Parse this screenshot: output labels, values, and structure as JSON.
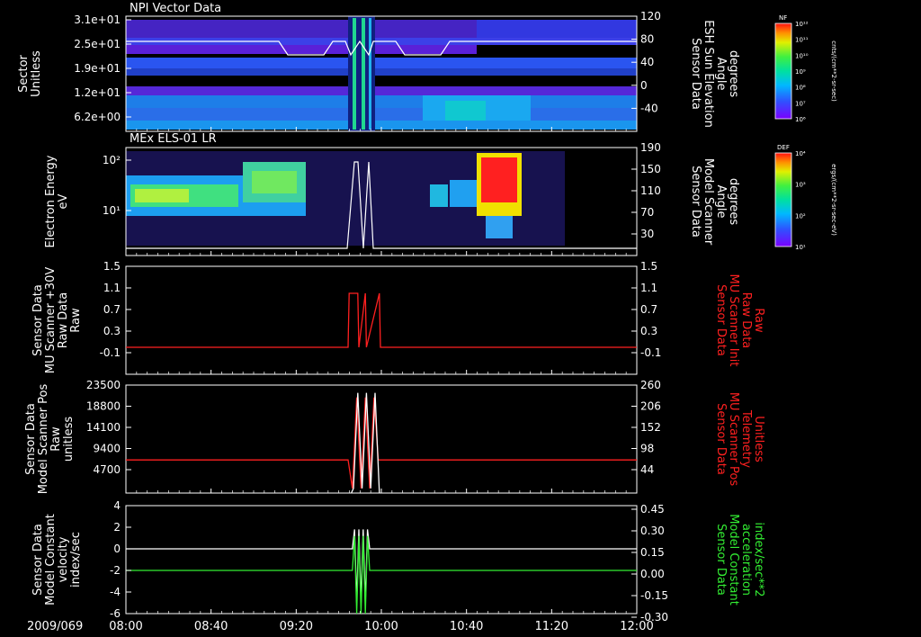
{
  "chart_data": [
    {
      "type": "heatmap",
      "panel": 1,
      "title": "NPI Vector Data",
      "ylabel": [
        "Sector",
        "Unitless"
      ],
      "yticks": [
        "3.1e+01",
        "2.5e+01",
        "1.9e+01",
        "1.2e+01",
        "6.2e+00"
      ],
      "y2label": [
        "Sensor Data",
        "ESH Sun Elevation",
        "Angle",
        "degrees"
      ],
      "y2ticks": [
        "120",
        "80",
        "40",
        "0",
        "-40"
      ],
      "y2lim": [
        -80,
        120
      ],
      "colorbar_label": "NF",
      "colorbar_units": "cnts/(cm**2-sr-sec)",
      "colorbar_ticks": [
        "10¹²",
        "10¹¹",
        "10¹⁰",
        "10⁹",
        "10⁸",
        "10⁷",
        "10⁶"
      ]
    },
    {
      "type": "heatmap",
      "panel": 2,
      "title": "MEx ELS-01 LR",
      "ylabel": [
        "Electron Energy",
        "eV"
      ],
      "yticks": [
        "10²",
        "10¹"
      ],
      "y2label": [
        "Sensor Data",
        "Model Scanner",
        "Angle",
        "degrees"
      ],
      "y2ticks": [
        "190",
        "150",
        "110",
        "70",
        "30"
      ],
      "y2lim": [
        0,
        190
      ],
      "colorbar_label": "DEF",
      "colorbar_units": "ergs/(cm**2-sr-sec-eV)",
      "colorbar_ticks": [
        "10⁴",
        "10³",
        "10²",
        "10¹"
      ]
    },
    {
      "type": "line",
      "panel": 3,
      "ylabel": [
        "Sensor Data",
        "MU Scanner +30V",
        "Raw Data",
        "Raw"
      ],
      "yticks": [
        "1.5",
        "1.1",
        "0.7",
        "0.3",
        "-0.1"
      ],
      "ylim": [
        -0.3,
        1.5
      ],
      "y2label": [
        "Sensor Data",
        "MU Scanner Init",
        "Raw Data",
        "Raw"
      ],
      "y2ticks": [
        "1.5",
        "1.1",
        "0.7",
        "0.3",
        "-0.1"
      ],
      "series": [
        {
          "color": "#ff2020",
          "x": [
            0,
            76,
            77,
            85,
            86,
            92,
            93,
            105,
            106,
            200
          ],
          "y": [
            0,
            0,
            1,
            1,
            0,
            1,
            0,
            1,
            0,
            0
          ]
        }
      ]
    },
    {
      "type": "line",
      "panel": 4,
      "ylabel": [
        "Sensor Data",
        "Model Scanner Pos",
        "Raw",
        "unitless"
      ],
      "yticks": [
        "23500",
        "18800",
        "14100",
        "9400",
        "4700"
      ],
      "ylim": [
        0,
        23500
      ],
      "y2label": [
        "Sensor Data",
        "MU Scanner Pos",
        "Telemetry",
        "Unitless"
      ],
      "y2ticks": [
        "260",
        "206",
        "152",
        "98",
        "44"
      ],
      "series": [
        {
          "color": "#ff2020",
          "x": [
            0,
            76,
            80,
            84,
            88,
            92,
            96,
            100,
            104,
            200
          ],
          "y": [
            7200,
            7200,
            1000,
            20800,
            1000,
            20800,
            1000,
            20800,
            7200,
            7200
          ]
        },
        {
          "color": "#ffffff",
          "x": [
            79,
            81,
            85,
            89,
            93,
            97,
            101,
            105
          ],
          "y": [
            0,
            1000,
            21800,
            1000,
            21800,
            1000,
            21800,
            0
          ]
        }
      ]
    },
    {
      "type": "line",
      "panel": 5,
      "ylabel": [
        "Sensor Data",
        "Model Constant",
        "velocity",
        "index/sec"
      ],
      "yticks": [
        "4",
        "2",
        "0",
        "-2",
        "-4",
        "-6"
      ],
      "ylim": [
        -6,
        4
      ],
      "y2label": [
        "Sensor Data",
        "Model Constant",
        "acceleration",
        "index/sec**2"
      ],
      "y2ticks": [
        "0.45",
        "0.30",
        "0.15",
        "0.00",
        "-0.15",
        "-0.30"
      ],
      "y2lim": [
        -0.3,
        0.45
      ],
      "series": [
        {
          "color": "#ffffff",
          "x": [
            0,
            80,
            82,
            84,
            86,
            88,
            90,
            92,
            94,
            96,
            200
          ],
          "y": [
            0,
            0,
            1.8,
            -5,
            1.8,
            -5,
            1.8,
            -5,
            1.8,
            0,
            0
          ]
        },
        {
          "color": "#33ee33",
          "x": [
            0,
            80,
            82,
            84,
            86,
            88,
            90,
            92,
            94,
            96,
            200
          ],
          "y": [
            -2,
            -2,
            1.2,
            -6,
            1.2,
            -6,
            1.2,
            -6,
            1.2,
            -2,
            -2
          ]
        }
      ]
    }
  ],
  "xaxis": {
    "date": "2009/069",
    "ticks": [
      "08:00",
      "08:40",
      "09:20",
      "10:00",
      "10:40",
      "11:20",
      "12:00"
    ],
    "xlim": [
      "08:00",
      "12:00"
    ]
  },
  "colors": {
    "red": "#ff2020",
    "green": "#33ee33",
    "white": "#ffffff"
  }
}
